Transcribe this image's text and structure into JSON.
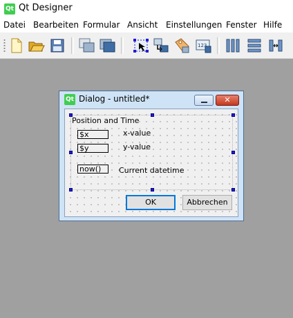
{
  "app": {
    "logo_text": "Qt",
    "title": "Qt Designer"
  },
  "menu": [
    "Datei",
    "Bearbeiten",
    "Formular",
    "Ansicht",
    "Einstellungen",
    "Fenster",
    "Hilfe"
  ],
  "toolbar": {
    "icons": [
      "new-file-icon",
      "open-folder-icon",
      "save-icon",
      "cascade-windows-icon",
      "tile-windows-icon",
      "edit-widgets-icon",
      "edit-signals-slots-icon",
      "edit-buddies-icon",
      "edit-tab-order-icon",
      "layout-horizontal-icon",
      "layout-vertical-icon",
      "layout-horizontal-splitter-icon"
    ]
  },
  "dialog": {
    "logo_text": "Qt",
    "title": "Dialog - untitled*",
    "close_glyph": "✕",
    "group_title": "Position and Time",
    "fields": [
      {
        "value": "$x",
        "label": "x-value"
      },
      {
        "value": "$y",
        "label": "y-value"
      },
      {
        "value": "now()",
        "label": "Current datetime"
      }
    ],
    "ok_label": "OK",
    "cancel_label": "Abbrechen"
  },
  "colors": {
    "workspace": "#a0a0a0",
    "dialog_frame": "#cfe3f6",
    "selection_handle": "#1d1dd1",
    "qt_green": "#41cd52"
  }
}
